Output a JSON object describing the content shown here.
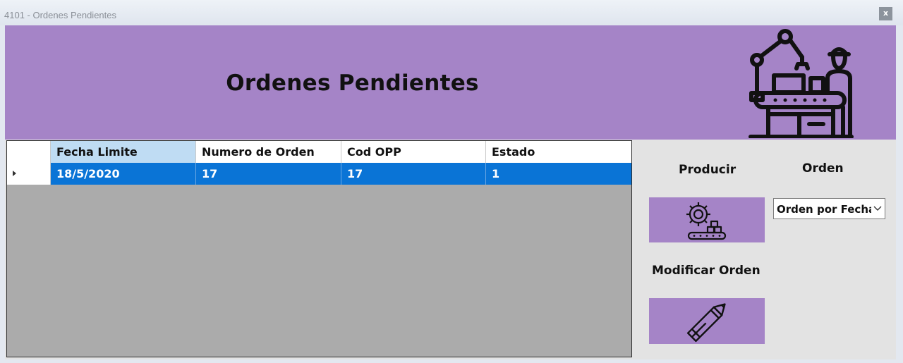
{
  "window": {
    "title": "4101 - Ordenes Pendientes",
    "close_label": "x"
  },
  "header": {
    "title": "Ordenes Pendientes",
    "background": "#a584c7",
    "icon": "factory-worker-robot-arm-icon"
  },
  "grid": {
    "columns": [
      "Fecha Limite",
      "Numero de Orden",
      "Cod OPP",
      "Estado"
    ],
    "sorted_column": "Fecha Limite",
    "rows": [
      [
        "18/5/2020",
        "17",
        "17",
        "1"
      ]
    ],
    "selected_row": 0,
    "selection_color": "#0a74d6",
    "empty_area_color": "#ababab"
  },
  "actions": {
    "producir_label": "Producir",
    "producir_icon": "gear-conveyor-icon",
    "modificar_label": "Modificar Orden",
    "modificar_icon": "pencil-icon",
    "button_color": "#a584c7"
  },
  "orden": {
    "label": "Orden",
    "selected": "Orden por Fecha"
  }
}
